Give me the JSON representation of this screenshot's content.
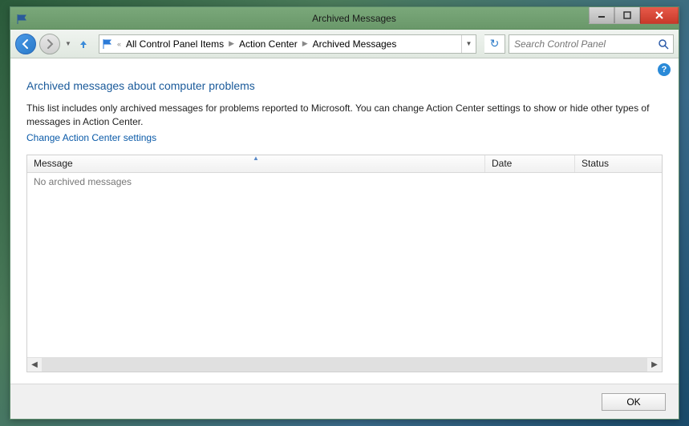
{
  "window": {
    "title": "Archived Messages"
  },
  "breadcrumbs": {
    "overflow": "«",
    "items": [
      "All Control Panel Items",
      "Action Center",
      "Archived Messages"
    ]
  },
  "search": {
    "placeholder": "Search Control Panel"
  },
  "page": {
    "heading": "Archived messages about computer problems",
    "description": "This list includes only archived messages for problems reported to Microsoft. You can change Action Center settings to show or hide other types of messages in Action Center.",
    "settings_link": "Change Action Center settings"
  },
  "table": {
    "columns": {
      "message": "Message",
      "date": "Date",
      "status": "Status"
    },
    "empty_text": "No archived messages",
    "rows": []
  },
  "buttons": {
    "ok": "OK"
  }
}
